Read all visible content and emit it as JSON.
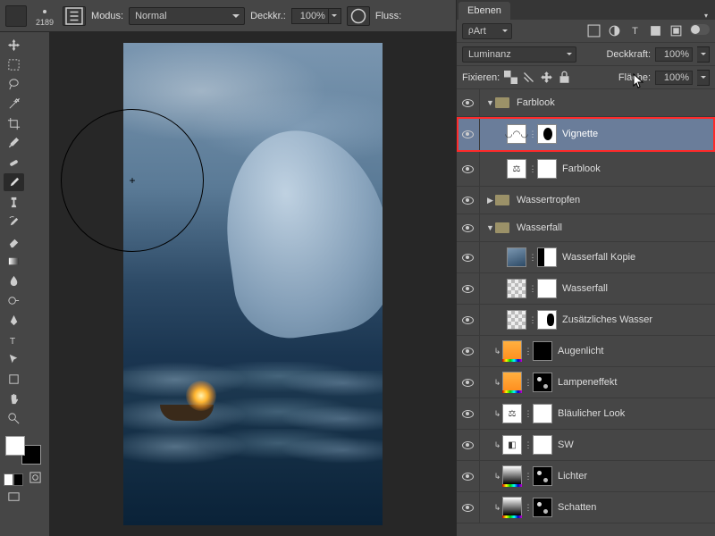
{
  "optbar": {
    "brush_size": "2189",
    "mode_label": "Modus:",
    "mode_value": "Normal",
    "opacity_label": "Deckkr.:",
    "opacity_value": "100%",
    "flow_label": "Fluss:"
  },
  "panel": {
    "tab": "Ebenen",
    "filter_value": "Art",
    "blend_value": "Luminanz",
    "opacity_label": "Deckkraft:",
    "opacity_value": "100%",
    "lock_label": "Fixieren:",
    "fill_label": "Fläche:",
    "fill_value": "100%"
  },
  "layers": {
    "grp_farblook": "Farblook",
    "vignette": "Vignette",
    "farblook": "Farblook",
    "grp_wassertropfen": "Wassertropfen",
    "grp_wasserfall": "Wasserfall",
    "wasserfall_kopie": "Wasserfall Kopie",
    "wasserfall": "Wasserfall",
    "zusaetzliches": "Zusätzliches Wasser",
    "augenlicht": "Augenlicht",
    "lampeneffekt": "Lampeneffekt",
    "blaeulicher": "Bläulicher Look",
    "sw": "SW",
    "lichter": "Lichter",
    "schatten": "Schatten"
  }
}
